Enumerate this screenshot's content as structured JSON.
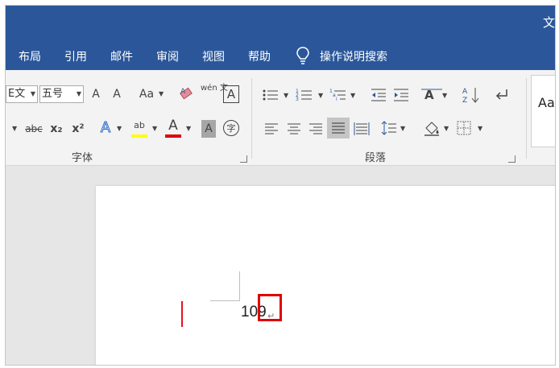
{
  "window": {
    "title_fragment": "文"
  },
  "tabs": [
    "布局",
    "引用",
    "邮件",
    "审阅",
    "视图",
    "帮助"
  ],
  "tell_me": "操作说明搜索",
  "font_group": {
    "label": "字体",
    "font_name": "E文",
    "font_size": "五号",
    "grow_label": "A",
    "shrink_label": "A",
    "change_case_label": "Aa",
    "phonetic_label": "wén 文",
    "char_border_label": "A",
    "strike_label": "abc",
    "sub_label": "x₂",
    "sup_label": "x²",
    "effects_label": "A",
    "highlight_label": "ab",
    "font_color_label": "A",
    "shading_label": "A",
    "enclose_label": "字"
  },
  "paragraph_group": {
    "label": "段落"
  },
  "styles_group": {
    "sample": "Aa"
  },
  "document": {
    "text": "109",
    "paragraph_mark": "↵"
  },
  "colors": {
    "title_bar": "#2b579a",
    "ribbon": "#f3f3f3",
    "highlight_box": "#e00000",
    "change_bar": "#e81123",
    "font_color_underline": "#e00000",
    "highlight_underline": "#ffff00"
  }
}
